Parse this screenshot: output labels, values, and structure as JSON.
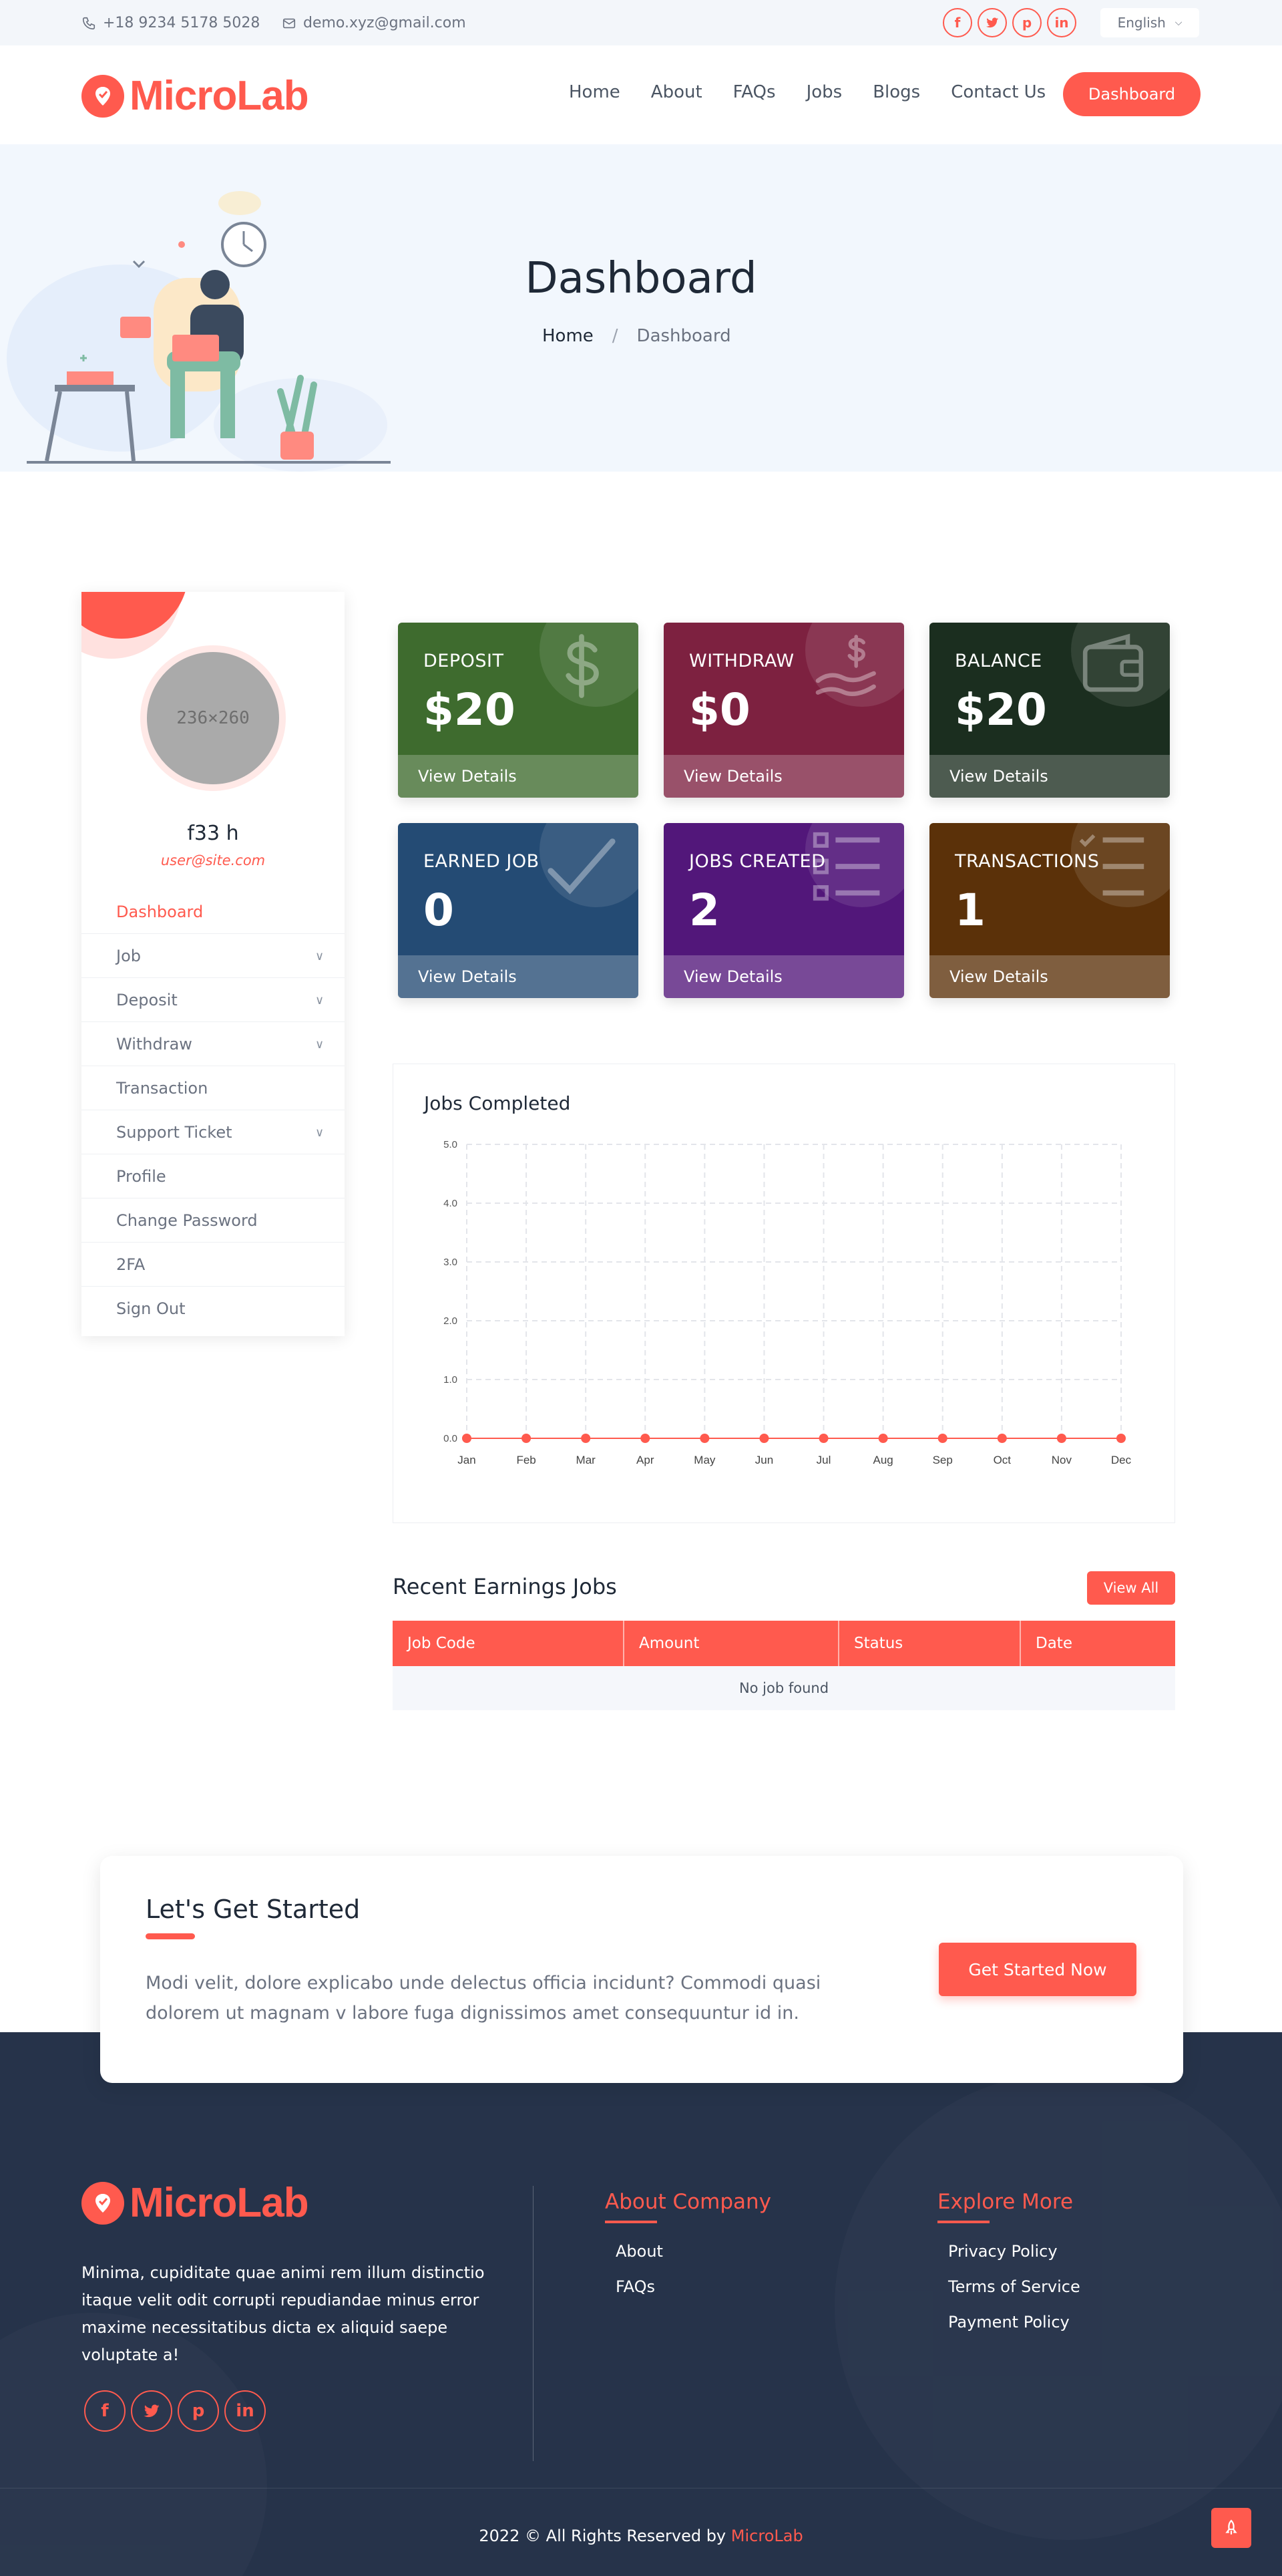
{
  "topbar": {
    "phone": "+18 9234 5178 5028",
    "email": "demo.xyz@gmail.com",
    "social": [
      "f",
      "t",
      "p",
      "in"
    ],
    "language": "English"
  },
  "navbar": {
    "brand": "MicroLab",
    "links": [
      "Home",
      "About",
      "FAQs",
      "Jobs",
      "Blogs",
      "Contact Us"
    ],
    "cta": "Dashboard"
  },
  "hero": {
    "title": "Dashboard",
    "breadcrumb_home": "Home",
    "breadcrumb_sep": "/",
    "breadcrumb_current": "Dashboard"
  },
  "profile": {
    "avatar_placeholder": "236×260",
    "name": "f33 h",
    "email": "user@site.com"
  },
  "sidebar_menu": [
    {
      "label": "Dashboard",
      "dropdown": false
    },
    {
      "label": "Job",
      "dropdown": true
    },
    {
      "label": "Deposit",
      "dropdown": true
    },
    {
      "label": "Withdraw",
      "dropdown": true
    },
    {
      "label": "Transaction",
      "dropdown": false
    },
    {
      "label": "Support Ticket",
      "dropdown": true
    },
    {
      "label": "Profile",
      "dropdown": false
    },
    {
      "label": "Change Password",
      "dropdown": false
    },
    {
      "label": "2FA",
      "dropdown": false
    },
    {
      "label": "Sign Out",
      "dropdown": false
    }
  ],
  "cards": [
    {
      "title": "DEPOSIT",
      "value": "$20",
      "link": "View Details",
      "color": "#3e6b2e",
      "icon": "dollar-icon"
    },
    {
      "title": "WITHDRAW",
      "value": "$0",
      "link": "View Details",
      "color": "#7d2140",
      "icon": "hand-money-icon"
    },
    {
      "title": "BALANCE",
      "value": "$20",
      "link": "View Details",
      "color": "#1b2e1f",
      "icon": "wallet-icon"
    },
    {
      "title": "EARNED JOB",
      "value": "0",
      "link": "View Details",
      "color": "#244b74",
      "icon": "check-icon"
    },
    {
      "title": "JOBS CREATED",
      "value": "2",
      "link": "View Details",
      "color": "#52177a",
      "icon": "list-icon"
    },
    {
      "title": "TRANSACTIONS",
      "value": "1",
      "link": "View Details",
      "color": "#5b3109",
      "icon": "checklist-icon"
    }
  ],
  "chart_data": {
    "type": "line",
    "title": "Jobs Completed",
    "categories": [
      "Jan",
      "Feb",
      "Mar",
      "Apr",
      "May",
      "Jun",
      "Jul",
      "Aug",
      "Sep",
      "Oct",
      "Nov",
      "Dec"
    ],
    "series": [
      {
        "values": [
          0,
          0,
          0,
          0,
          0,
          0,
          0,
          0,
          0,
          0,
          0,
          0
        ],
        "color": "#ff5a4e"
      }
    ],
    "yticks": [
      "0.0",
      "1.0",
      "2.0",
      "3.0",
      "4.0",
      "5.0"
    ],
    "ylim": [
      0,
      5
    ],
    "grid": true
  },
  "earnings": {
    "title": "Recent Earnings Jobs",
    "view_all": "View All",
    "columns": [
      "Job Code",
      "Amount",
      "Status",
      "Date"
    ],
    "empty": "No job found"
  },
  "cta": {
    "title": "Let's Get Started",
    "text": "Modi velit, dolore explicabo unde delectus officia incidunt? Commodi quasi dolorem ut magnam v labore fuga dignissimos amet consequuntur id in.",
    "button": "Get Started Now"
  },
  "footer": {
    "brand": "MicroLab",
    "about": "Minima, cupiditate quae animi rem illum distinctio itaque velit odit corrupti repudiandae minus error maxime necessitatibus dicta ex aliquid saepe voluptate a!",
    "company_title": "About Company",
    "company_links": [
      "About",
      "FAQs"
    ],
    "explore_title": "Explore More",
    "explore_links": [
      "Privacy Policy",
      "Terms of Service",
      "Payment Policy"
    ],
    "copyright_prefix": "2022 © All Rights Reserved by",
    "copyright_brand": "MicroLab"
  },
  "colors": {
    "accent": "#ff5a4e",
    "footer_bg": "#26334a",
    "hero_bg": "#f2f7fd"
  }
}
